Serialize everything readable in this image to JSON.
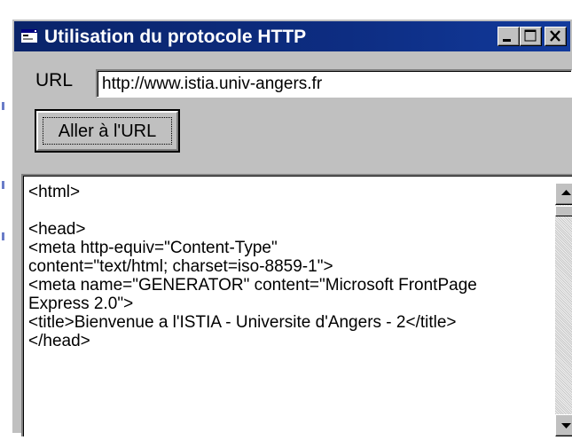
{
  "window": {
    "title": "Utilisation du protocole HTTP"
  },
  "url_field": {
    "label": "URL",
    "value": "http://www.istia.univ-angers.fr"
  },
  "go_button": {
    "label": "Aller à l'URL"
  },
  "response_lines": [
    "<html>",
    "",
    "<head>",
    "<meta http-equiv=\"Content-Type\"",
    "content=\"text/html; charset=iso-8859-1\">",
    "<meta name=\"GENERATOR\" content=\"Microsoft FrontPage",
    "Express 2.0\">",
    "<title>Bienvenue a l'ISTIA - Universite d'Angers - 2</title>",
    "</head>"
  ],
  "colors": {
    "titlebar_start": "#0a246a",
    "face": "#c0c0c0"
  }
}
